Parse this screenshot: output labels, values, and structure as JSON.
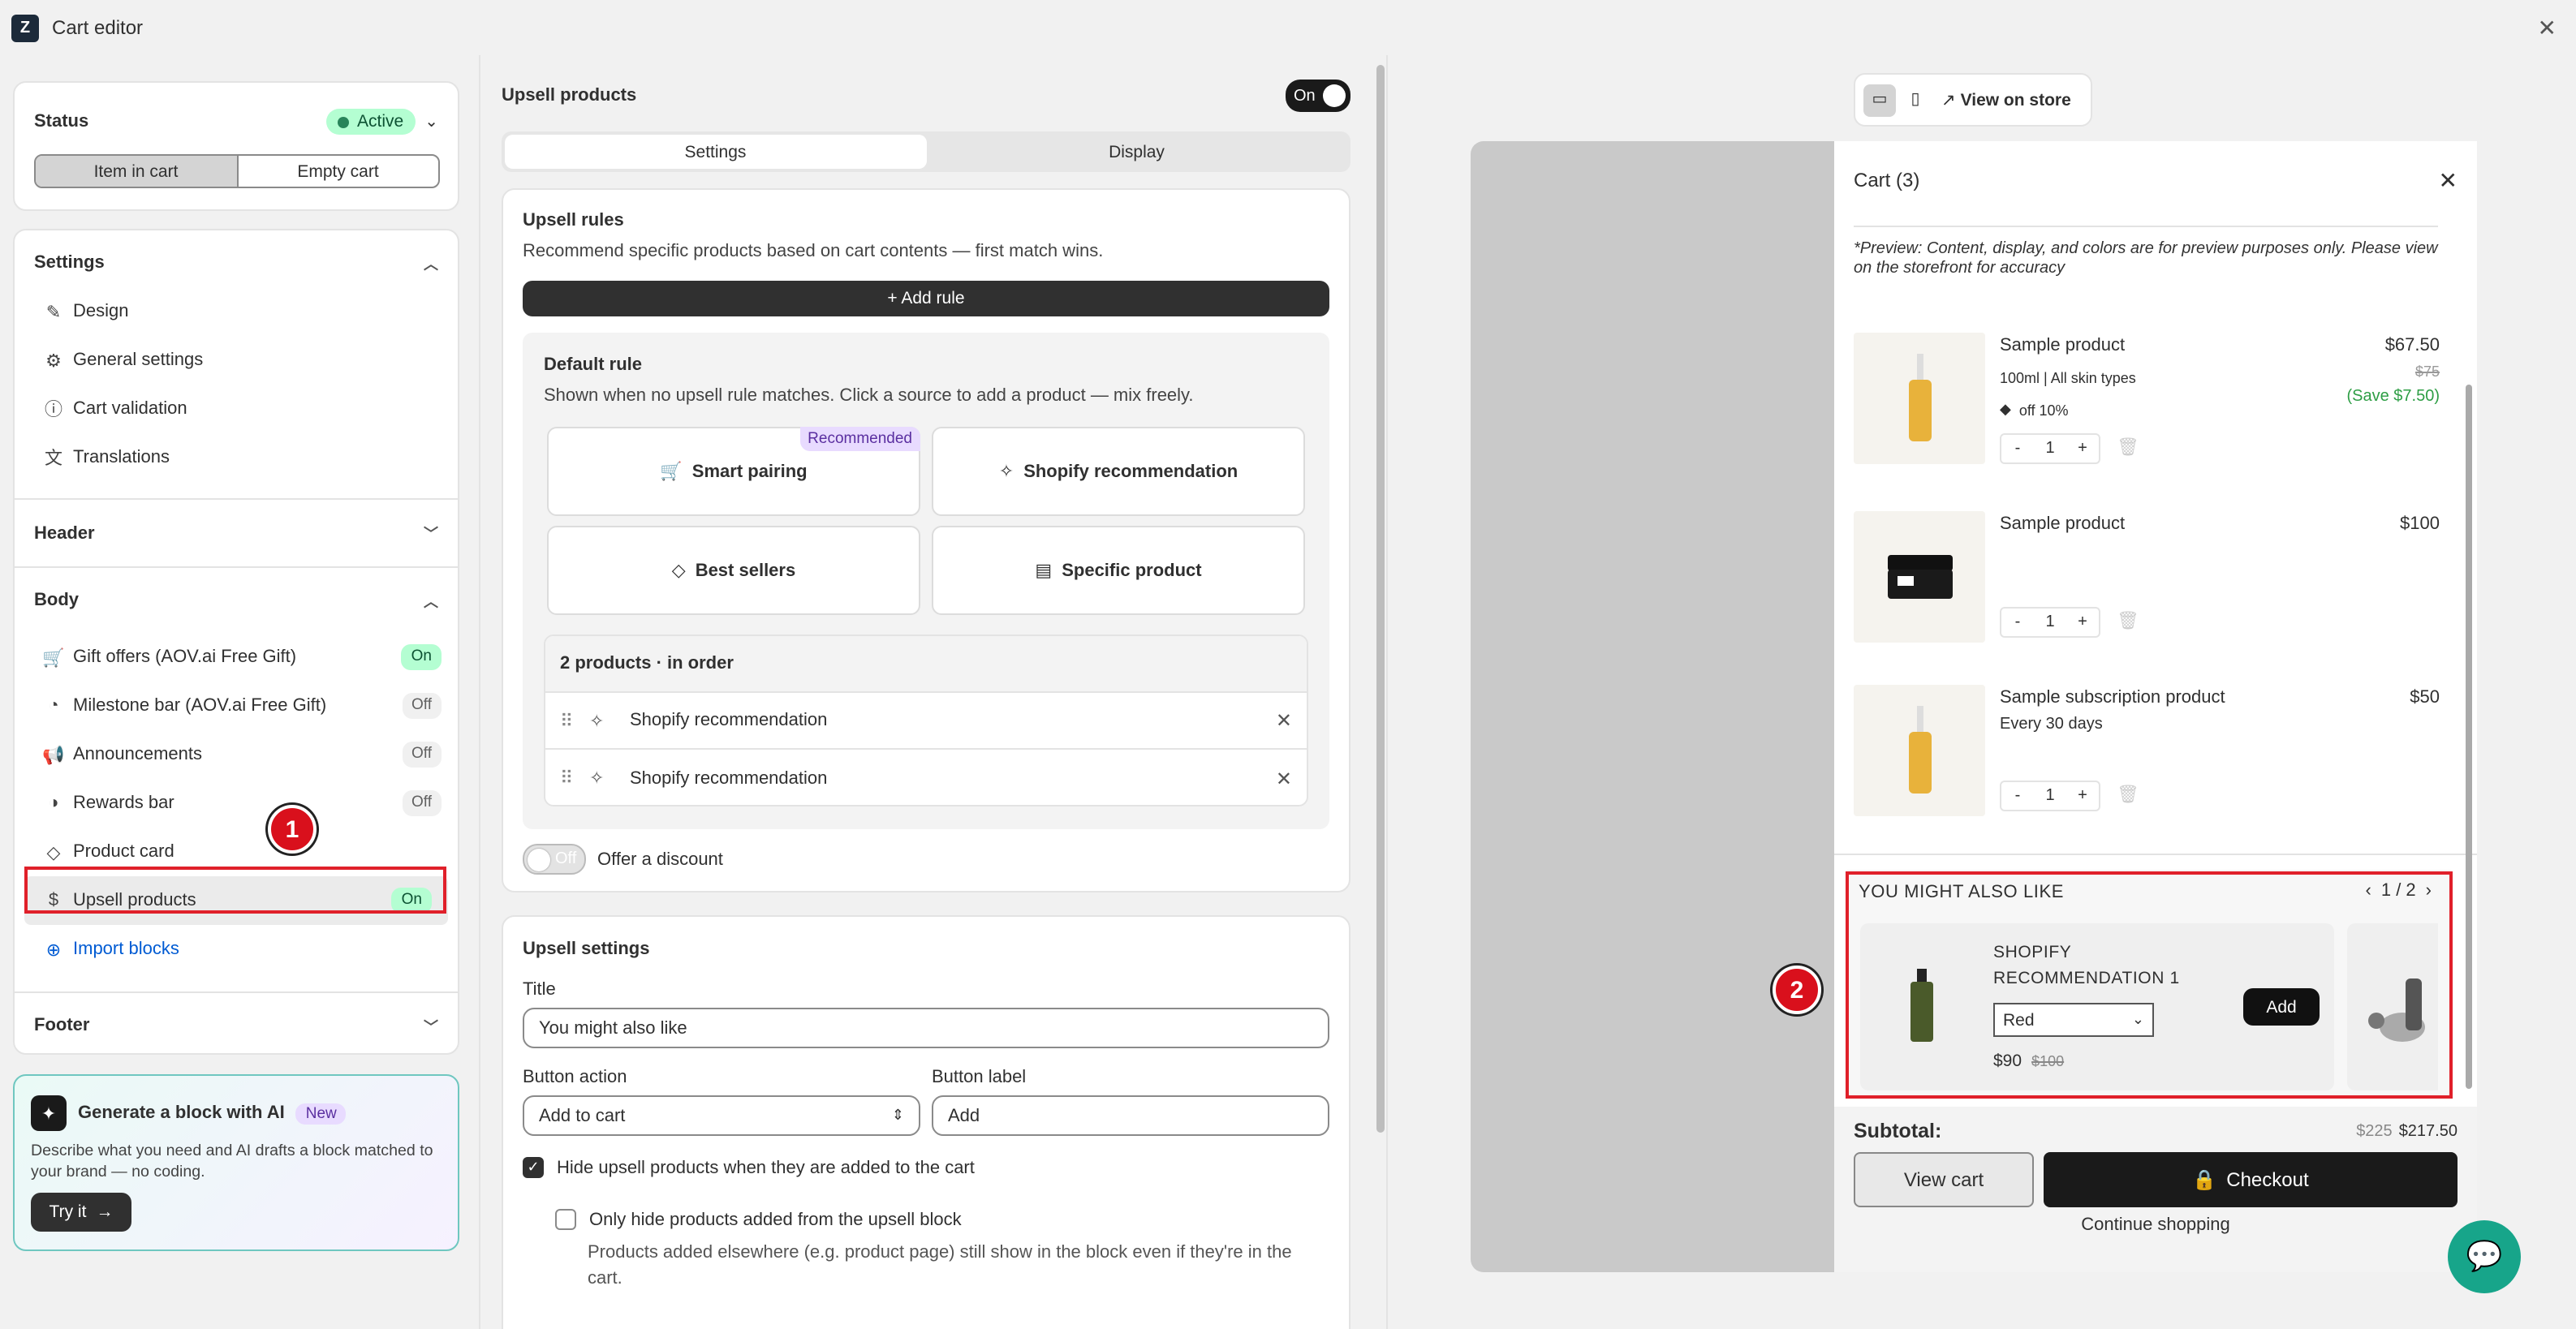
{
  "app": {
    "title": "Cart editor"
  },
  "status": {
    "label": "Status",
    "badge": "Active",
    "tabs": [
      "Item in cart",
      "Empty cart"
    ]
  },
  "settings": {
    "title": "Settings",
    "items": [
      "Design",
      "General settings",
      "Cart validation",
      "Translations"
    ]
  },
  "header_section": {
    "title": "Header"
  },
  "body_section": {
    "title": "Body",
    "items": [
      {
        "label": "Gift offers (AOV.ai Free Gift)",
        "state": "On"
      },
      {
        "label": "Milestone bar (AOV.ai Free Gift)",
        "state": "Off"
      },
      {
        "label": "Announcements",
        "state": "Off"
      },
      {
        "label": "Rewards bar",
        "state": "Off"
      },
      {
        "label": "Product card",
        "state": ""
      },
      {
        "label": "Upsell products",
        "state": "On"
      }
    ],
    "import": "Import blocks"
  },
  "footer_section": {
    "title": "Footer"
  },
  "ai": {
    "title": "Generate a block with AI",
    "badge": "New",
    "desc": "Describe what you need and AI drafts a block matched to your brand — no coding.",
    "cta": "Try it"
  },
  "annotations": [
    "1",
    "2"
  ],
  "editor": {
    "title": "Upsell products",
    "toggle": "On",
    "tabs": [
      "Settings",
      "Display"
    ],
    "rules_title": "Upsell rules",
    "rules_desc": "Recommend specific products based on cart contents — first match wins.",
    "add_rule": "+ Add rule",
    "default_title": "Default rule",
    "default_desc": "Shown when no upsell rule matches. Click a source to add a product — mix freely.",
    "sources": {
      "smart": "Smart pairing",
      "recommended": "Recommended",
      "shopify": "Shopify recommendation",
      "best": "Best sellers",
      "specific": "Specific product"
    },
    "list_title": "2 products · in order",
    "list": [
      "Shopify recommendation",
      "Shopify recommendation"
    ],
    "discount_toggle": "Off",
    "discount_label": "Offer a discount",
    "settings_title": "Upsell settings",
    "title_label": "Title",
    "title_value": "You might also like",
    "action_label": "Button action",
    "action_value": "Add to cart",
    "btnlabel_label": "Button label",
    "btnlabel_value": "Add",
    "hide_label": "Hide upsell products when they are added to the cart",
    "only_hide_label": "Only hide products added from the upsell block",
    "only_hide_desc": "Products added elsewhere (e.g. product page) still show in the block even if they're in the cart."
  },
  "preview": {
    "view_store": "View on store",
    "cart_title": "Cart (3)",
    "note": "*Preview: Content, display, and colors are for preview purposes only. Please view on the storefront for accuracy",
    "items": [
      {
        "name": "Sample product",
        "meta": "100ml | All skin types",
        "tag": "off 10%",
        "price": "$67.50",
        "compare": "$75",
        "save": "(Save $7.50)",
        "qty": "1"
      },
      {
        "name": "Sample product",
        "meta": "",
        "tag": "",
        "price": "$100",
        "compare": "",
        "save": "",
        "qty": "1"
      },
      {
        "name": "Sample subscription product",
        "meta": "Every 30 days",
        "tag": "",
        "price": "$50",
        "compare": "",
        "save": "",
        "qty": "1"
      }
    ],
    "upsell": {
      "title": "YOU MIGHT ALSO LIKE",
      "pager": "1 / 2",
      "product": "SHOPIFY RECOMMENDATION 1",
      "variant": "Red",
      "price": "$90",
      "compare": "$100",
      "add": "Add"
    },
    "subtotal_label": "Subtotal:",
    "subtotal_compare": "$225",
    "subtotal": "$217.50",
    "view_cart": "View cart",
    "checkout": "Checkout",
    "continue": "Continue shopping"
  }
}
